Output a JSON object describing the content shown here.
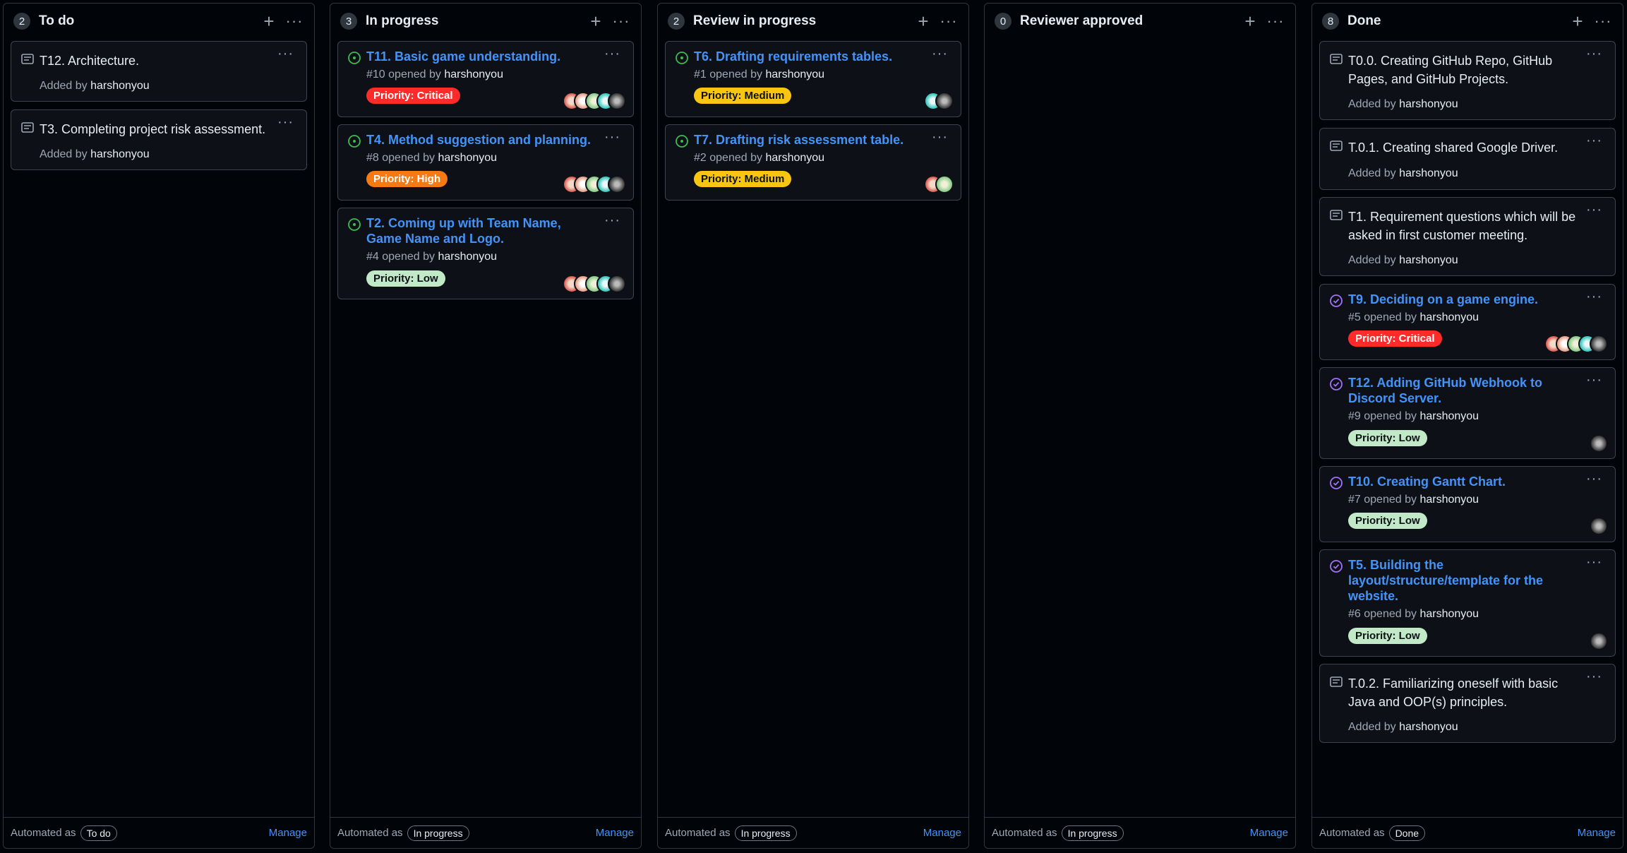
{
  "colors": {
    "critical": "#ff2a2a",
    "high": "#f57a14",
    "medium": "#f8c611",
    "low": "#c2e9c7",
    "issue_open": "#3fb950",
    "issue_closed": "#a371f7",
    "link": "#4493f8"
  },
  "columns": [
    {
      "count": "2",
      "title": "To do",
      "footer": {
        "prefix": "Automated as",
        "pill": "To do",
        "manage": "Manage"
      },
      "cards": [
        {
          "type": "note",
          "text": "T12. Architecture.",
          "added_prefix": "Added by",
          "user": "harshonyou"
        },
        {
          "type": "note",
          "text": "T3. Completing project risk assessment.",
          "added_prefix": "Added by",
          "user": "harshonyou"
        }
      ]
    },
    {
      "count": "3",
      "title": "In progress",
      "footer": {
        "prefix": "Automated as",
        "pill": "In progress",
        "manage": "Manage"
      },
      "cards": [
        {
          "type": "issue",
          "state": "open",
          "title": "T11. Basic game understanding.",
          "number": "#10",
          "opened": "opened by",
          "user": "harshonyou",
          "label": "Priority: Critical",
          "avatars": [
            "mosaic-red",
            "mosaic-peach",
            "mosaic-green",
            "mosaic-teal",
            "photo-gray"
          ]
        },
        {
          "type": "issue",
          "state": "open",
          "title": "T4. Method suggestion and planning.",
          "number": "#8",
          "opened": "opened by",
          "user": "harshonyou",
          "label": "Priority: High",
          "avatars": [
            "mosaic-red",
            "mosaic-peach",
            "mosaic-green",
            "mosaic-teal",
            "photo-gray"
          ]
        },
        {
          "type": "issue",
          "state": "open",
          "title": "T2. Coming up with Team Name, Game Name and Logo.",
          "number": "#4",
          "opened": "opened by",
          "user": "harshonyou",
          "label": "Priority: Low",
          "avatars": [
            "mosaic-red",
            "mosaic-peach",
            "mosaic-green",
            "mosaic-teal",
            "photo-gray"
          ]
        }
      ]
    },
    {
      "count": "2",
      "title": "Review in progress",
      "footer": {
        "prefix": "Automated as",
        "pill": "In progress",
        "manage": "Manage"
      },
      "cards": [
        {
          "type": "issue",
          "state": "open",
          "title": "T6. Drafting requirements tables.",
          "number": "#1",
          "opened": "opened by",
          "user": "harshonyou",
          "label": "Priority: Medium",
          "avatars": [
            "mosaic-teal",
            "photo-gray"
          ]
        },
        {
          "type": "issue",
          "state": "open",
          "title": "T7. Drafting risk assessment table.",
          "number": "#2",
          "opened": "opened by",
          "user": "harshonyou",
          "label": "Priority: Medium",
          "avatars": [
            "mosaic-red",
            "mosaic-green"
          ]
        }
      ]
    },
    {
      "count": "0",
      "title": "Reviewer approved",
      "footer": {
        "prefix": "Automated as",
        "pill": "In progress",
        "manage": "Manage"
      },
      "cards": []
    },
    {
      "count": "8",
      "title": "Done",
      "footer": {
        "prefix": "Automated as",
        "pill": "Done",
        "manage": "Manage"
      },
      "cards": [
        {
          "type": "note",
          "text": "T0.0. Creating GitHub Repo, GitHub Pages, and GitHub Projects.",
          "added_prefix": "Added by",
          "user": "harshonyou"
        },
        {
          "type": "note",
          "text": "T.0.1. Creating shared Google Driver.",
          "added_prefix": "Added by",
          "user": "harshonyou"
        },
        {
          "type": "note",
          "text": "T1. Requirement questions which will be asked in first customer meeting.",
          "added_prefix": "Added by",
          "user": "harshonyou"
        },
        {
          "type": "issue",
          "state": "closed",
          "title": "T9. Deciding on a game engine.",
          "number": "#5",
          "opened": "opened by",
          "user": "harshonyou",
          "label": "Priority: Critical",
          "avatars": [
            "mosaic-red",
            "mosaic-peach",
            "mosaic-green",
            "mosaic-teal",
            "photo-gray"
          ]
        },
        {
          "type": "issue",
          "state": "closed",
          "title": "T12. Adding GitHub Webhook to Discord Server.",
          "number": "#9",
          "opened": "opened by",
          "user": "harshonyou",
          "label": "Priority: Low",
          "avatars": [
            "photo-gray"
          ]
        },
        {
          "type": "issue",
          "state": "closed",
          "title": "T10. Creating Gantt Chart.",
          "number": "#7",
          "opened": "opened by",
          "user": "harshonyou",
          "label": "Priority: Low",
          "avatars": [
            "photo-gray"
          ]
        },
        {
          "type": "issue",
          "state": "closed",
          "title": "T5. Building the layout/structure/template for the website.",
          "number": "#6",
          "opened": "opened by",
          "user": "harshonyou",
          "label": "Priority: Low",
          "avatars": [
            "photo-gray"
          ]
        },
        {
          "type": "note",
          "text": "T.0.2. Familiarizing oneself with basic Java and OOP(s) principles.",
          "added_prefix": "Added by",
          "user": "harshonyou"
        }
      ]
    }
  ]
}
